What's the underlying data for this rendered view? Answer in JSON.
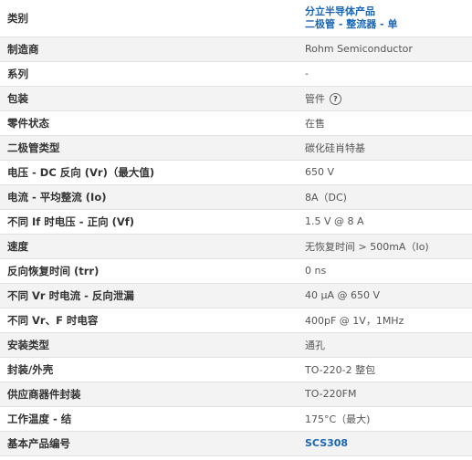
{
  "spec": {
    "category": {
      "label": "类别",
      "line1": "分立半导体产品",
      "line2": "二极管 - 整流器 - 单"
    },
    "rows": [
      {
        "label": "制造商",
        "value": "Rohm Semiconductor"
      },
      {
        "label": "系列",
        "value": "-"
      },
      {
        "label": "包装",
        "value": "管件",
        "help_icon": "help-circle-icon",
        "help_glyph": "?"
      },
      {
        "label": "零件状态",
        "value": "在售"
      },
      {
        "label": "二极管类型",
        "value": "碳化硅肖特基"
      },
      {
        "label": "电压 - DC 反向 (Vr)（最大值)",
        "value": "650 V"
      },
      {
        "label": "电流 - 平均整流 (Io)",
        "value": "8A（DC)"
      },
      {
        "label": "不同 If 时电压 - 正向 (Vf)",
        "value": "1.5 V @ 8 A"
      },
      {
        "label": "速度",
        "value": "无恢复时间 > 500mA（Io)"
      },
      {
        "label": "反向恢复时间 (trr)",
        "value": "0 ns"
      },
      {
        "label": "不同 Vr 时电流 - 反向泄漏",
        "value": "40 µA @ 650 V"
      },
      {
        "label": "不同 Vr、F 时电容",
        "value": "400pF @ 1V，1MHz"
      },
      {
        "label": "安装类型",
        "value": "通孔"
      },
      {
        "label": "封装/外壳",
        "value": "TO-220-2 整包"
      },
      {
        "label": "供应商器件封装",
        "value": "TO-220FM"
      },
      {
        "label": "工作温度 - 结",
        "value": "175°C（最大)"
      },
      {
        "label": "基本产品编号",
        "value": "SCS308"
      }
    ]
  },
  "colors": {
    "link": "#1a66b3",
    "row_alt": "#f3f3f3",
    "label_text": "#333333",
    "value_text": "#555555"
  }
}
